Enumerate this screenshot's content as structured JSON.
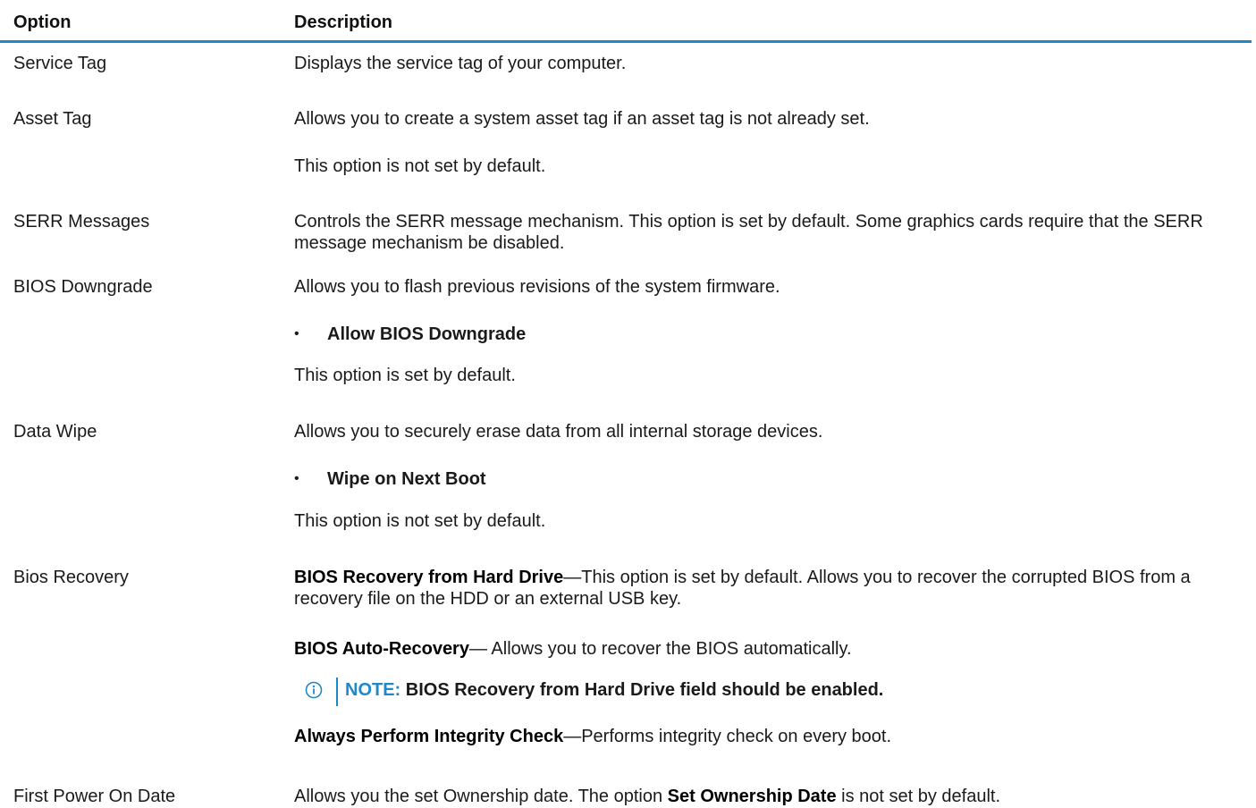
{
  "header": {
    "option": "Option",
    "description": "Description"
  },
  "rows": {
    "service_tag": {
      "option": "Service Tag",
      "desc": "Displays the service tag of your computer."
    },
    "asset_tag": {
      "option": "Asset Tag",
      "desc1": "Allows you to create a system asset tag if an asset tag is not already set.",
      "desc2": "This option is not set by default."
    },
    "serr": {
      "option": "SERR Messages",
      "desc": "Controls the SERR message mechanism. This option is set by default. Some graphics cards require that the SERR message mechanism be disabled."
    },
    "bios_downgrade": {
      "option": "BIOS Downgrade",
      "desc1": "Allows you to flash previous revisions of the system firmware.",
      "bullet": "Allow BIOS Downgrade",
      "desc2": "This option is set by default."
    },
    "data_wipe": {
      "option": "Data Wipe",
      "desc1": "Allows you to securely erase data from all internal storage devices.",
      "bullet": "Wipe on Next Boot",
      "desc2": "This option is not set by default."
    },
    "bios_recovery": {
      "option": "Bios Recovery",
      "p1_bold": "BIOS Recovery from Hard Drive",
      "p1_rest": "—This option is set by default. Allows you to recover the corrupted BIOS from a recovery file on the HDD or an external USB key.",
      "p2_bold": "BIOS Auto-Recovery",
      "p2_rest": "— Allows you to recover the BIOS automatically.",
      "note_label": "NOTE:",
      "note_text": " BIOS Recovery from Hard Drive field should be enabled.",
      "p3_bold": "Always Perform Integrity Check",
      "p3_rest": "—Performs integrity check on every boot."
    },
    "first_power_on": {
      "option": "First Power On Date",
      "desc_pre": "Allows you the set Ownership date. The option ",
      "desc_bold": "Set Ownership Date",
      "desc_post": " is not set by default."
    }
  },
  "colors": {
    "accent": "#1e88c8"
  },
  "icons": {
    "note": "info-circle-icon"
  }
}
